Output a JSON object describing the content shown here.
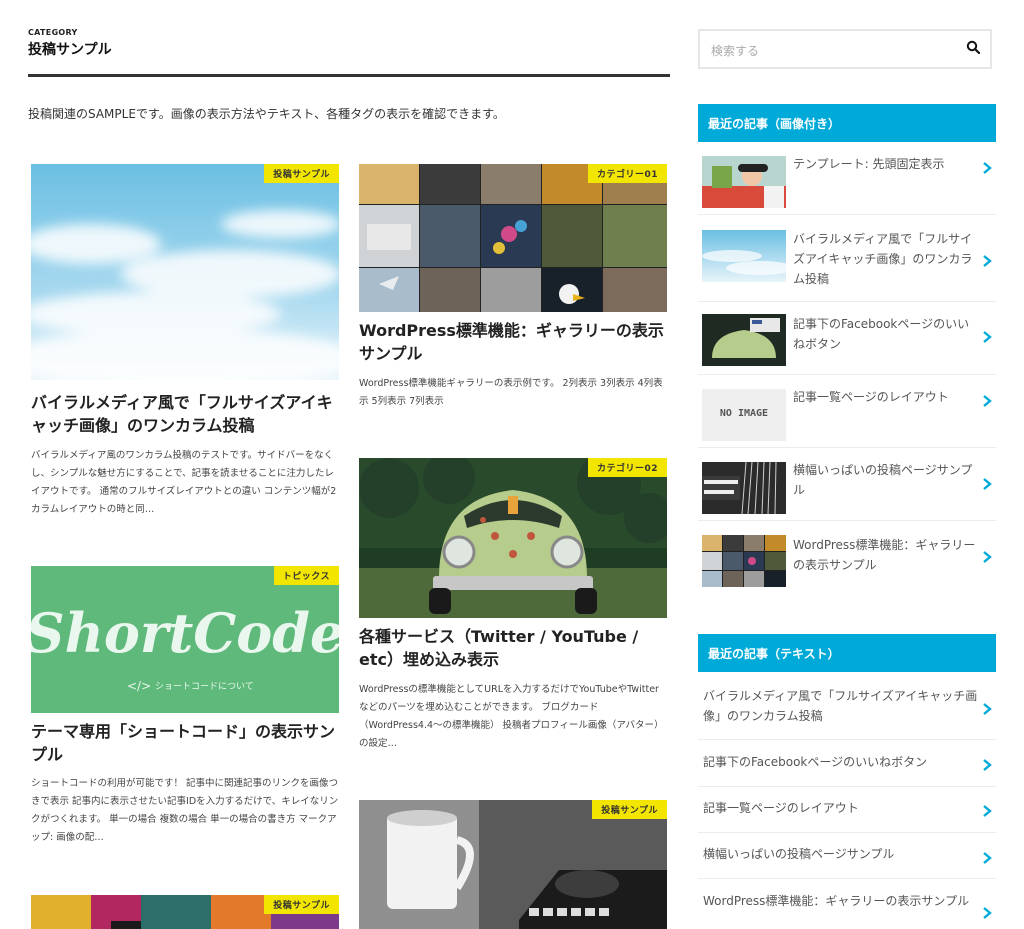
{
  "category": {
    "label": "CATEGORY",
    "title": "投稿サンプル",
    "intro": "投稿関連のSAMPLEです。画像の表示方法やテキスト、各種タグの表示を確認できます。"
  },
  "posts": [
    {
      "badge": "投稿サンプル",
      "title": "バイラルメディア風で「フルサイズアイキャッチ画像」のワンカラム投稿",
      "excerpt": "バイラルメディア風のワンカラム投稿のテストです。サイドバーをなくし、シンプルな魅せ方にすることで、記事を読ませることに注力したレイアウトです。 通常のフルサイズレイアウトとの違い コンテンツ幅が2カラムレイアウトの時と同…"
    },
    {
      "badge": "カテゴリー01",
      "title": "WordPress標準機能：ギャラリーの表示サンプル",
      "excerpt": "WordPress標準機能ギャラリーの表示例です。 2列表示 3列表示 4列表示 5列表示 7列表示"
    },
    {
      "badge": "トピックス",
      "title": "テーマ専用「ショートコード」の表示サンプル",
      "excerpt": "ショートコードの利用が可能です！ 記事中に関連記事のリンクを画像つきで表示 記事内に表示させたい記事IDを入力するだけで、キレイなリンクがつくれます。 単一の場合 複数の場合 単一の場合の書き方 マークアップ: 画像の配…",
      "image_text": "ShortCode",
      "image_sub": "ショートコードについて"
    },
    {
      "badge": "カテゴリー02",
      "title": "各種サービス（Twitter / YouTube / etc）埋め込み表示",
      "excerpt": "WordPressの標準機能としてURLを入力するだけでYouTubeやTwitterなどのパーツを埋め込むことができます。 ブログカード（WordPress4.4～の標準機能） 投稿者プロフィール画像（アバター）の設定…"
    },
    {
      "badge": "投稿サンプル"
    },
    {
      "badge": "投稿サンプル"
    }
  ],
  "sidebar": {
    "search_placeholder": "検索する",
    "widget_image": {
      "title": "最近の記事（画像付き）",
      "items": [
        {
          "title": "テンプレート: 先頭固定表示"
        },
        {
          "title": "バイラルメディア風で「フルサイズアイキャッチ画像」のワンカラム投稿"
        },
        {
          "title": "記事下のFacebookページのいいねボタン"
        },
        {
          "title": "記事一覧ページのレイアウト",
          "noimage": "NO IMAGE"
        },
        {
          "title": "横幅いっぱいの投稿ページサンプル"
        },
        {
          "title": "WordPress標準機能：ギャラリーの表示サンプル"
        }
      ]
    },
    "widget_text": {
      "title": "最近の記事（テキスト）",
      "items": [
        {
          "title": "バイラルメディア風で「フルサイズアイキャッチ画像」のワンカラム投稿"
        },
        {
          "title": "記事下のFacebookページのいいねボタン"
        },
        {
          "title": "記事一覧ページのレイアウト"
        },
        {
          "title": "横幅いっぱいの投稿ページサンプル"
        },
        {
          "title": "WordPress標準機能：ギャラリーの表示サンプル"
        }
      ]
    }
  },
  "colors": {
    "accent": "#00aad8",
    "badge": "#f2e500",
    "rule": "#333333"
  }
}
